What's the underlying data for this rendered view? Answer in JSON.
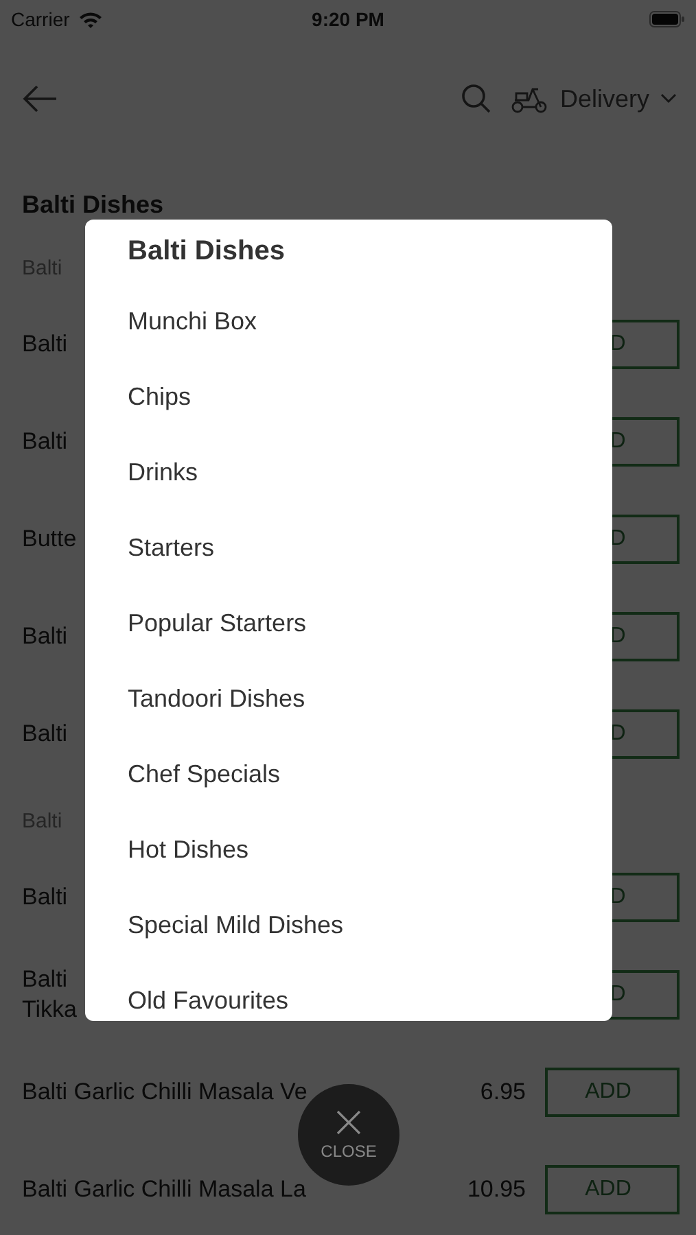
{
  "status_bar": {
    "carrier": "Carrier",
    "time": "9:20 PM"
  },
  "nav": {
    "mode": "Delivery"
  },
  "menu_title": "Balti Dishes",
  "sections": [
    {
      "title": "Balti",
      "items": [
        {
          "name_lines": [
            "Balti"
          ],
          "button": "D"
        },
        {
          "name_lines": [
            "Balti"
          ],
          "button": "D"
        },
        {
          "name_lines": [
            "Butte"
          ],
          "button": "D"
        },
        {
          "name_lines": [
            "Balti"
          ],
          "button": "D"
        },
        {
          "name_lines": [
            "Balti"
          ],
          "button": "D"
        }
      ]
    },
    {
      "title": "Balti",
      "items": [
        {
          "name_lines": [
            "Balti"
          ],
          "button": "D"
        },
        {
          "name_lines": [
            "Balti",
            "Tikka"
          ],
          "button": "D"
        },
        {
          "name_lines": [
            "Balti Garlic Chilli Masala Ve"
          ],
          "price": "6.95",
          "button": "ADD"
        },
        {
          "name_lines": [
            "Balti Garlic Chilli Masala La"
          ],
          "price": "10.95",
          "button": "ADD"
        }
      ]
    }
  ],
  "dialog": {
    "title": "Balti Dishes",
    "items": [
      "Munchi Box",
      "Chips",
      "Drinks",
      "Starters",
      "Popular Starters",
      "Tandoori Dishes",
      "Chef Specials",
      "Hot Dishes",
      "Special Mild Dishes",
      "Old Favourites"
    ]
  },
  "close_button": "CLOSE"
}
